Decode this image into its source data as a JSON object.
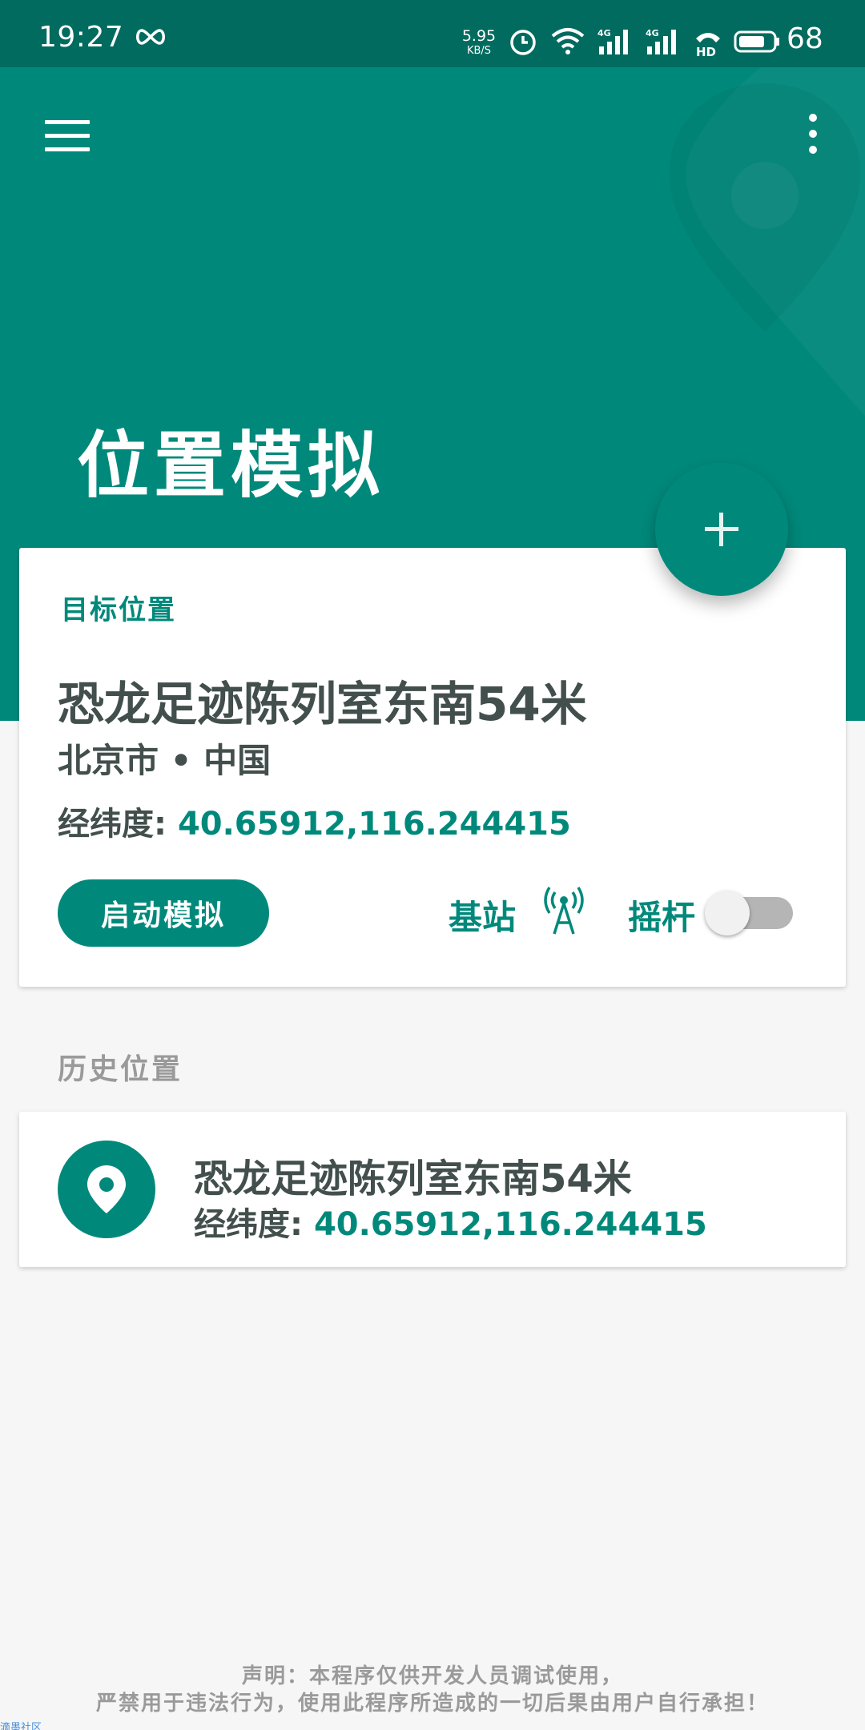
{
  "status_bar": {
    "time": "19:27",
    "net_speed_value": "5.95",
    "net_speed_unit": "KB/S",
    "battery_level": "68"
  },
  "header": {
    "title": "位置模拟"
  },
  "target": {
    "section_label": "目标位置",
    "name": "恐龙足迹陈列室东南54米",
    "region": "北京市 • 中国",
    "coords_label": "经纬度:",
    "coords_value": "40.65912,116.244415",
    "start_button": "启动模拟",
    "station_label": "基站",
    "joystick_label": "摇杆"
  },
  "history": {
    "section_label": "历史位置",
    "items": [
      {
        "name": "恐龙足迹陈列室东南54米",
        "coords_label": "经纬度:",
        "coords_value": "40.65912,116.244415"
      }
    ]
  },
  "disclaimer": {
    "line1": "声明：本程序仅供开发人员调试使用，",
    "line2": "严禁用于违法行为，使用此程序所造成的一切后果由用户自行承担！"
  },
  "watermark": "滴墨社区",
  "colors": {
    "primary": "#00897b",
    "primary_dark": "#006b5e",
    "text_dark": "#424f4c",
    "text_muted": "#9a9a9a"
  },
  "icons": {
    "menu": "menu-icon",
    "more": "more-vert-icon",
    "add": "plus-icon",
    "station": "antenna-icon",
    "history_item": "location-pin-icon"
  },
  "toggles": {
    "joystick_on": false
  }
}
